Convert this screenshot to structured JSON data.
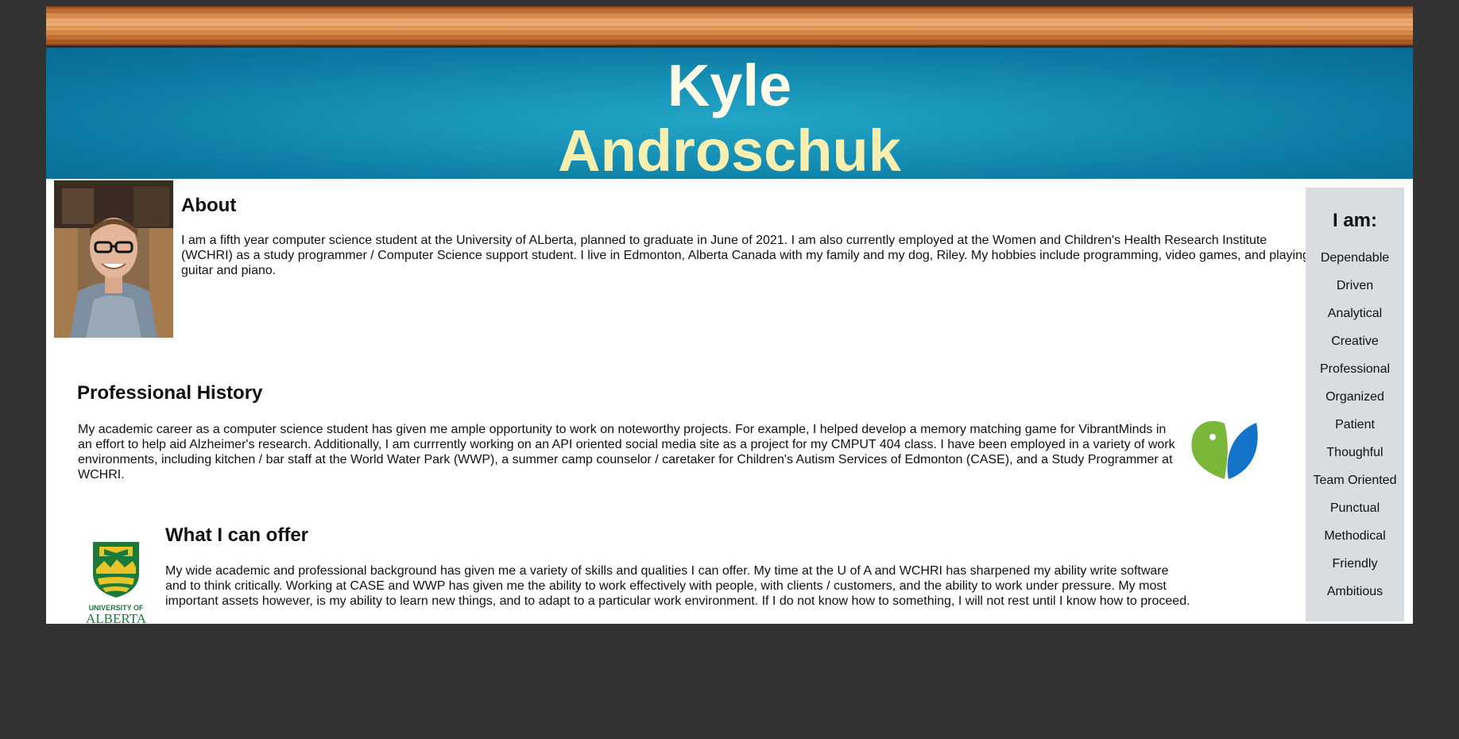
{
  "header": {
    "first_name": "Kyle",
    "last_name": "Androschuk"
  },
  "about": {
    "title": "About",
    "text": "I am a fifth year computer science student at the University of ALberta, planned to graduate in June of 2021. I am also currently employed at the Women and Children's Health Research Institute (WCHRI) as a study programmer / Computer Science support student. I live in Edmonton, Alberta Canada with my family and my dog, Riley. My hobbies include programming, video games, and playing guitar and piano."
  },
  "history": {
    "title": "Professional History",
    "text": "My academic career as a computer science student has given me ample opportunity to work on noteworthy projects. For example, I helped develop a memory matching game for VibrantMinds in an effort to help aid Alzheimer's research. Additionally, I am currrently working on an API oriented social media site as a project for my CMPUT 404 class. I have been employed in a variety of work environments, including kitchen / bar staff at the World Water Park (WWP), a summer camp counselor / caretaker for Children's Autism Services of Edmonton (CASE), and a Study Programmer at WCHRI."
  },
  "offer": {
    "title": "What I can offer",
    "text": "My wide academic and professional background has given me a variety of skills and qualities I can offer. My time at the U of A and WCHRI has sharpened my ability write software and to think critically. Working at CASE and WWP has given me the ability to work effectively with people, with clients / customers, and the ability to work under pressure. My most important assets however, is my ability to learn new things, and to adapt to a particular work environment. If I do not know how to something, I will not rest until I know how to proceed."
  },
  "ua_logo": {
    "line1": "UNIVERSITY OF",
    "line2": "ALBERTA"
  },
  "sidebar": {
    "title": "I am:",
    "traits": [
      "Dependable",
      "Driven",
      "Analytical",
      "Creative",
      "Professional",
      "Organized",
      "Patient",
      "Thoughful",
      "Team Oriented",
      "Punctual",
      "Methodical",
      "Friendly",
      "Ambitious"
    ]
  },
  "colors": {
    "page_background": "#333333",
    "banner_blue": "#1792b6",
    "name_first": "#fffbe6",
    "name_last": "#f6efb0",
    "sidebar_bg": "#d8dde2",
    "ua_green": "#1b7a3a",
    "ua_gold": "#e8c32a",
    "vm_green": "#7ab637",
    "vm_blue": "#1273c8"
  }
}
